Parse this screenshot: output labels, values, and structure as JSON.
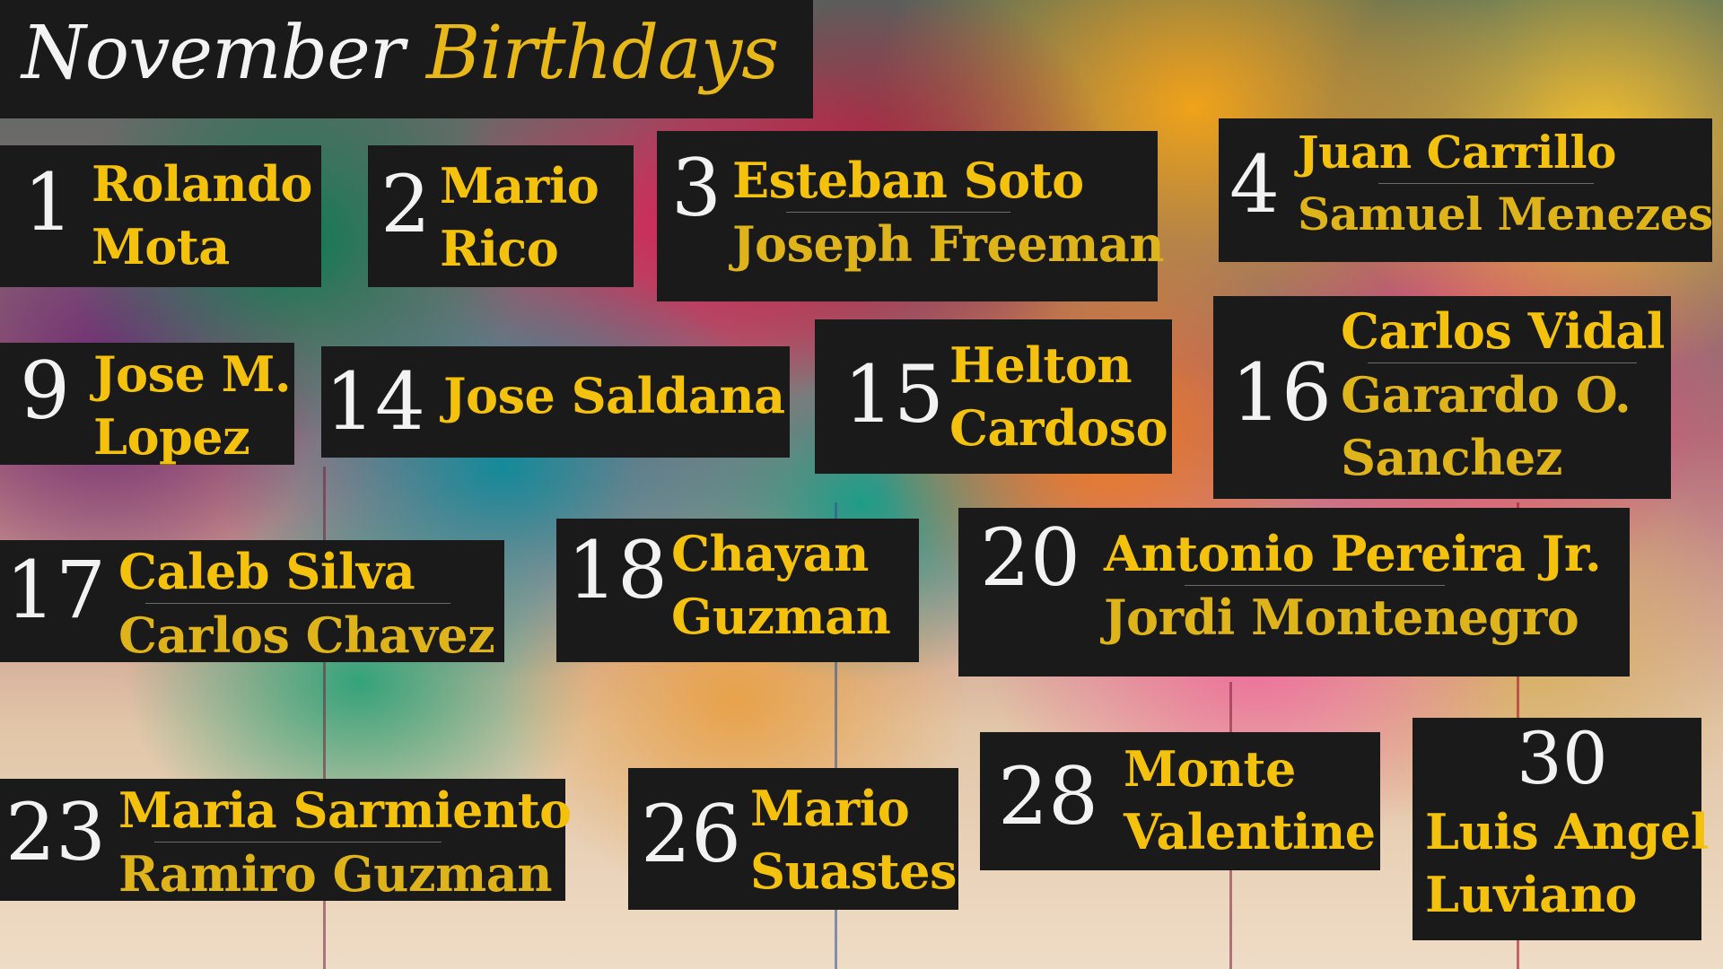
{
  "title": {
    "word1": "November",
    "word2": "Birthdays"
  },
  "colors": {
    "card_background": "#1b1a1a",
    "day_number": "#f2f2f2",
    "name_text": "#f4c20d",
    "title_accent": "#e8b818"
  },
  "birthdays": [
    {
      "day": "1",
      "names": [
        "Rolando",
        "Mota"
      ]
    },
    {
      "day": "2",
      "names": [
        "Mario",
        "Rico"
      ]
    },
    {
      "day": "3",
      "names": [
        "Esteban Soto",
        "Joseph Freeman"
      ]
    },
    {
      "day": "4",
      "names": [
        "Juan Carrillo",
        "Samuel Menezes"
      ]
    },
    {
      "day": "9",
      "names": [
        "Jose M.",
        "Lopez"
      ]
    },
    {
      "day": "14",
      "names": [
        "Jose Saldana"
      ]
    },
    {
      "day": "15",
      "names": [
        "Helton",
        "Cardoso"
      ]
    },
    {
      "day": "16",
      "names": [
        "Carlos Vidal",
        "Garardo O.",
        "Sanchez"
      ]
    },
    {
      "day": "17",
      "names": [
        "Caleb Silva",
        "Carlos Chavez"
      ]
    },
    {
      "day": "18",
      "names": [
        "Chayan",
        "Guzman"
      ]
    },
    {
      "day": "20",
      "names": [
        "Antonio Pereira Jr.",
        "Jordi Montenegro"
      ]
    },
    {
      "day": "23",
      "names": [
        "Maria Sarmiento",
        "Ramiro Guzman"
      ]
    },
    {
      "day": "26",
      "names": [
        "Mario",
        "Suastes"
      ]
    },
    {
      "day": "28",
      "names": [
        "Monte",
        "Valentine"
      ]
    },
    {
      "day": "30",
      "names": [
        "Luis Angel",
        "Luviano"
      ]
    }
  ]
}
